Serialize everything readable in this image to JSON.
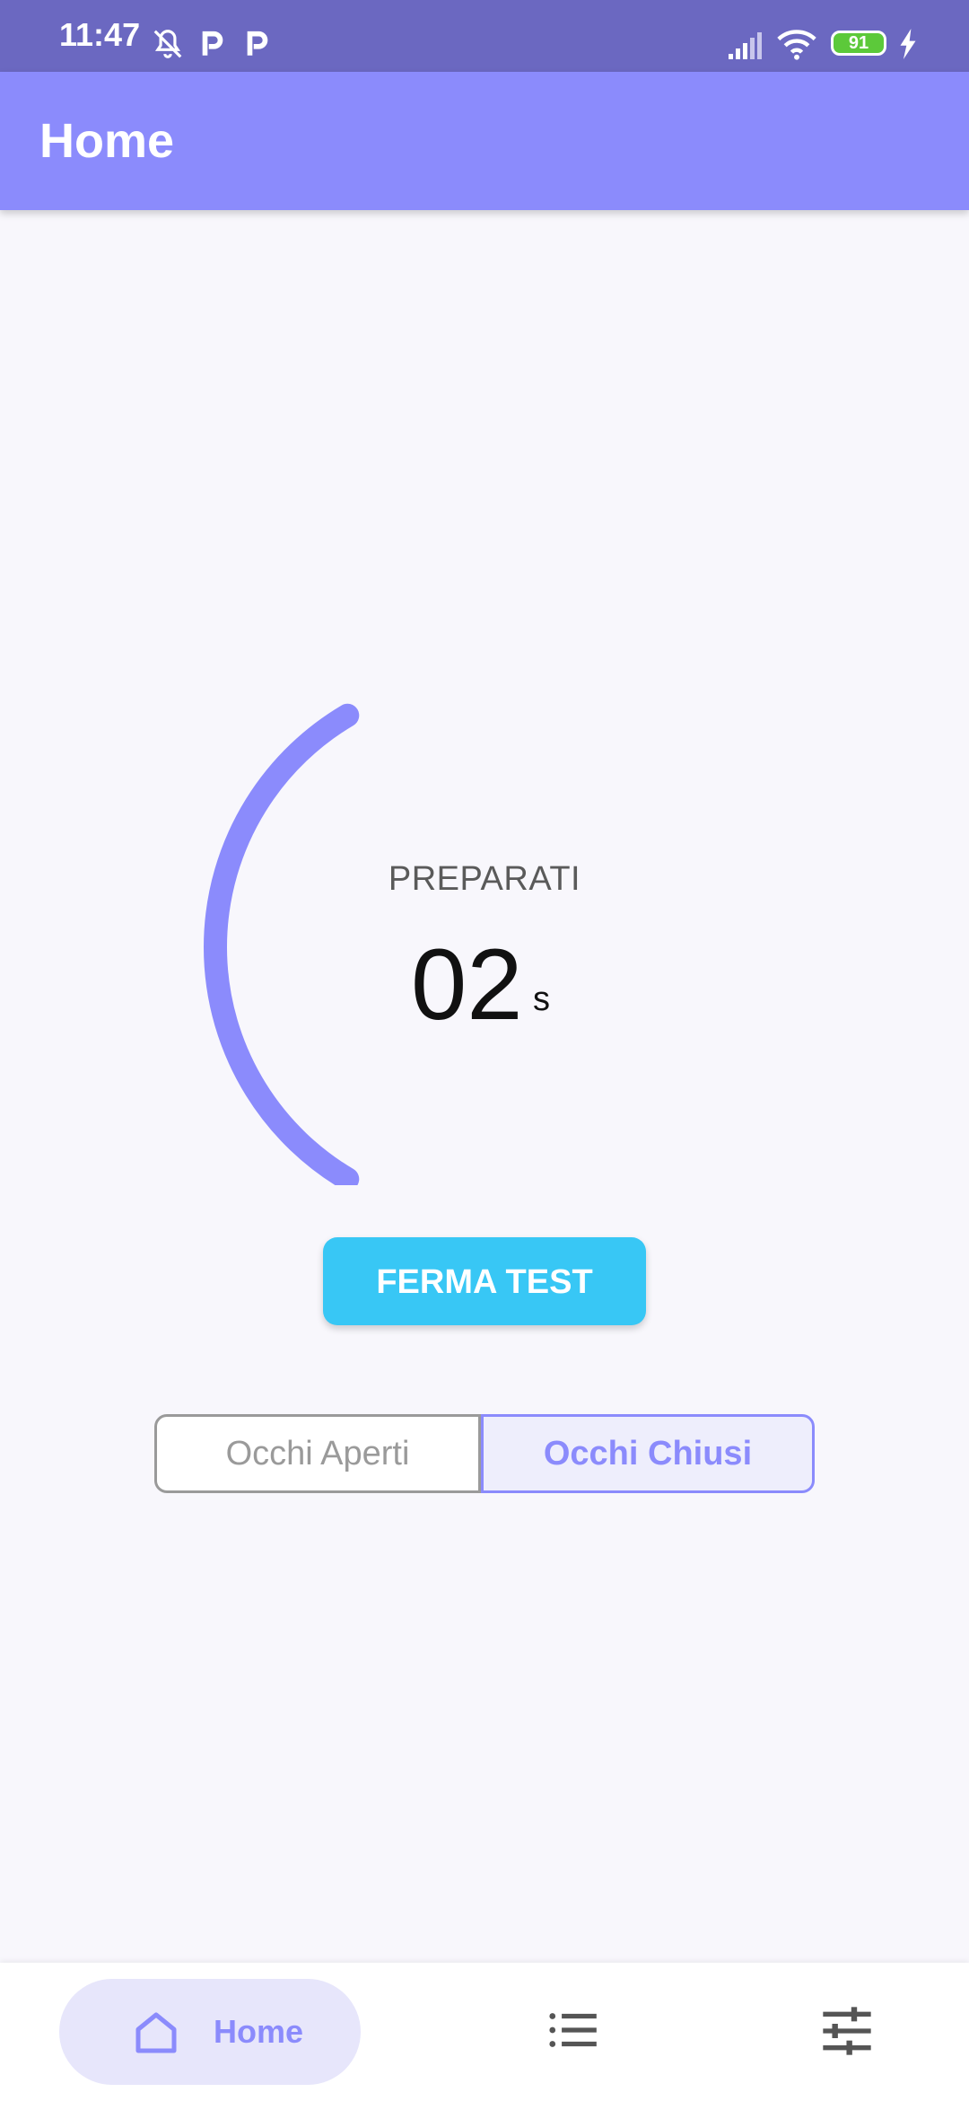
{
  "status_bar": {
    "time": "11:47",
    "battery": "91",
    "icons": [
      "bell-off-icon",
      "parking-icon",
      "parking-icon",
      "signal-icon",
      "wifi-icon",
      "battery-icon",
      "charging-icon"
    ]
  },
  "app_bar": {
    "title": "Home"
  },
  "timer": {
    "phase_label": "PREPARATI",
    "value": "02",
    "unit": "s",
    "progress_fraction": 0.33
  },
  "stop_button": {
    "label": "FERMA TEST"
  },
  "mode_toggle": {
    "options": [
      "Occhi Aperti",
      "Occhi Chiusi"
    ],
    "selected": "Occhi Chiusi"
  },
  "bottom_nav": {
    "items": [
      {
        "label": "Home",
        "icon": "home-icon",
        "active": true
      },
      {
        "label": "",
        "icon": "list-icon",
        "active": false
      },
      {
        "label": "",
        "icon": "sliders-icon",
        "active": false
      }
    ]
  },
  "colors": {
    "primary": "#8b8bfc",
    "status_bar": "#6b68c1",
    "accent_button": "#38c7f5",
    "background": "#f8f7fc"
  }
}
